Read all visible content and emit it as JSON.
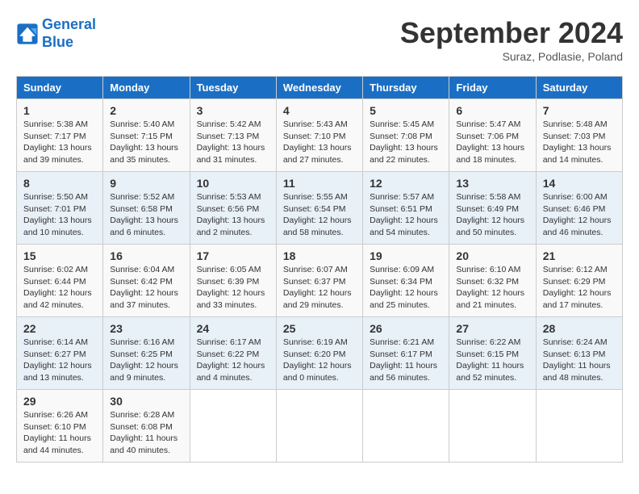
{
  "logo": {
    "line1": "General",
    "line2": "Blue"
  },
  "title": "September 2024",
  "subtitle": "Suraz, Podlasie, Poland",
  "days_header": [
    "Sunday",
    "Monday",
    "Tuesday",
    "Wednesday",
    "Thursday",
    "Friday",
    "Saturday"
  ],
  "weeks": [
    [
      {
        "day": "1",
        "info": "Sunrise: 5:38 AM\nSunset: 7:17 PM\nDaylight: 13 hours\nand 39 minutes."
      },
      {
        "day": "2",
        "info": "Sunrise: 5:40 AM\nSunset: 7:15 PM\nDaylight: 13 hours\nand 35 minutes."
      },
      {
        "day": "3",
        "info": "Sunrise: 5:42 AM\nSunset: 7:13 PM\nDaylight: 13 hours\nand 31 minutes."
      },
      {
        "day": "4",
        "info": "Sunrise: 5:43 AM\nSunset: 7:10 PM\nDaylight: 13 hours\nand 27 minutes."
      },
      {
        "day": "5",
        "info": "Sunrise: 5:45 AM\nSunset: 7:08 PM\nDaylight: 13 hours\nand 22 minutes."
      },
      {
        "day": "6",
        "info": "Sunrise: 5:47 AM\nSunset: 7:06 PM\nDaylight: 13 hours\nand 18 minutes."
      },
      {
        "day": "7",
        "info": "Sunrise: 5:48 AM\nSunset: 7:03 PM\nDaylight: 13 hours\nand 14 minutes."
      }
    ],
    [
      {
        "day": "8",
        "info": "Sunrise: 5:50 AM\nSunset: 7:01 PM\nDaylight: 13 hours\nand 10 minutes."
      },
      {
        "day": "9",
        "info": "Sunrise: 5:52 AM\nSunset: 6:58 PM\nDaylight: 13 hours\nand 6 minutes."
      },
      {
        "day": "10",
        "info": "Sunrise: 5:53 AM\nSunset: 6:56 PM\nDaylight: 13 hours\nand 2 minutes."
      },
      {
        "day": "11",
        "info": "Sunrise: 5:55 AM\nSunset: 6:54 PM\nDaylight: 12 hours\nand 58 minutes."
      },
      {
        "day": "12",
        "info": "Sunrise: 5:57 AM\nSunset: 6:51 PM\nDaylight: 12 hours\nand 54 minutes."
      },
      {
        "day": "13",
        "info": "Sunrise: 5:58 AM\nSunset: 6:49 PM\nDaylight: 12 hours\nand 50 minutes."
      },
      {
        "day": "14",
        "info": "Sunrise: 6:00 AM\nSunset: 6:46 PM\nDaylight: 12 hours\nand 46 minutes."
      }
    ],
    [
      {
        "day": "15",
        "info": "Sunrise: 6:02 AM\nSunset: 6:44 PM\nDaylight: 12 hours\nand 42 minutes."
      },
      {
        "day": "16",
        "info": "Sunrise: 6:04 AM\nSunset: 6:42 PM\nDaylight: 12 hours\nand 37 minutes."
      },
      {
        "day": "17",
        "info": "Sunrise: 6:05 AM\nSunset: 6:39 PM\nDaylight: 12 hours\nand 33 minutes."
      },
      {
        "day": "18",
        "info": "Sunrise: 6:07 AM\nSunset: 6:37 PM\nDaylight: 12 hours\nand 29 minutes."
      },
      {
        "day": "19",
        "info": "Sunrise: 6:09 AM\nSunset: 6:34 PM\nDaylight: 12 hours\nand 25 minutes."
      },
      {
        "day": "20",
        "info": "Sunrise: 6:10 AM\nSunset: 6:32 PM\nDaylight: 12 hours\nand 21 minutes."
      },
      {
        "day": "21",
        "info": "Sunrise: 6:12 AM\nSunset: 6:29 PM\nDaylight: 12 hours\nand 17 minutes."
      }
    ],
    [
      {
        "day": "22",
        "info": "Sunrise: 6:14 AM\nSunset: 6:27 PM\nDaylight: 12 hours\nand 13 minutes."
      },
      {
        "day": "23",
        "info": "Sunrise: 6:16 AM\nSunset: 6:25 PM\nDaylight: 12 hours\nand 9 minutes."
      },
      {
        "day": "24",
        "info": "Sunrise: 6:17 AM\nSunset: 6:22 PM\nDaylight: 12 hours\nand 4 minutes."
      },
      {
        "day": "25",
        "info": "Sunrise: 6:19 AM\nSunset: 6:20 PM\nDaylight: 12 hours\nand 0 minutes."
      },
      {
        "day": "26",
        "info": "Sunrise: 6:21 AM\nSunset: 6:17 PM\nDaylight: 11 hours\nand 56 minutes."
      },
      {
        "day": "27",
        "info": "Sunrise: 6:22 AM\nSunset: 6:15 PM\nDaylight: 11 hours\nand 52 minutes."
      },
      {
        "day": "28",
        "info": "Sunrise: 6:24 AM\nSunset: 6:13 PM\nDaylight: 11 hours\nand 48 minutes."
      }
    ],
    [
      {
        "day": "29",
        "info": "Sunrise: 6:26 AM\nSunset: 6:10 PM\nDaylight: 11 hours\nand 44 minutes."
      },
      {
        "day": "30",
        "info": "Sunrise: 6:28 AM\nSunset: 6:08 PM\nDaylight: 11 hours\nand 40 minutes."
      },
      null,
      null,
      null,
      null,
      null
    ]
  ]
}
